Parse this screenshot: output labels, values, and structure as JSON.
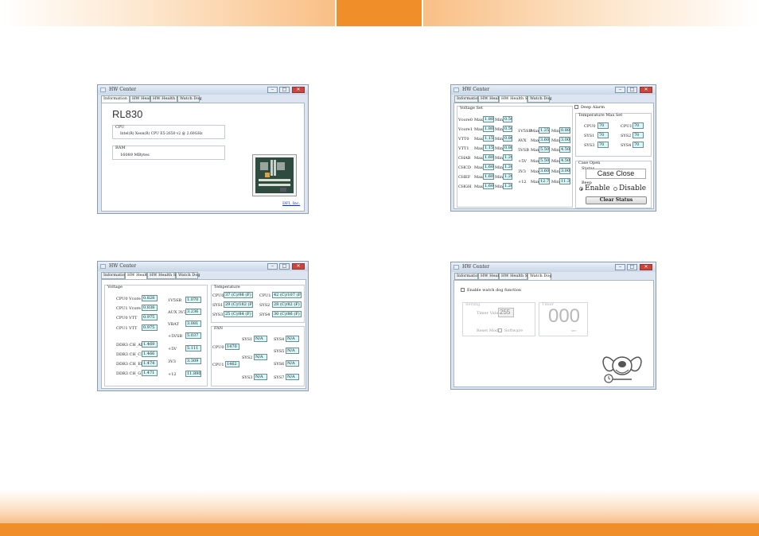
{
  "header": {
    "tab_label": ""
  },
  "colors": {
    "accent": "#f08f2a"
  },
  "window_title": "HW Center",
  "tabs": [
    "Information",
    "HW Health",
    "HW Health Set",
    "Watch Dog"
  ],
  "info": {
    "model": "RL830",
    "cpu_label": "CPU",
    "cpu_value": "Intel(R) Xeon(R) CPU E5-2650 v2 @ 2.60GHz",
    "ram_label": "RAM",
    "ram_value": "16089 MBytes",
    "link": "DFI, Inc."
  },
  "health_set": {
    "voltage_title": "Voltage Set",
    "left": [
      {
        "label": "Vcore0",
        "max": "1.80",
        "min": "0.50"
      },
      {
        "label": "Vcore1",
        "max": "1.80",
        "min": "0.50"
      },
      {
        "label": "VTT0",
        "max": "1.15",
        "min": "0.80"
      },
      {
        "label": "VTT1",
        "max": "1.15",
        "min": "0.80"
      },
      {
        "label": "CHAB",
        "max": "1.60",
        "min": "1.20"
      },
      {
        "label": "CHCD",
        "max": "1.60",
        "min": "1.20"
      },
      {
        "label": "CHEF",
        "max": "1.60",
        "min": "1.20"
      },
      {
        "label": "CHGH",
        "max": "1.60",
        "min": "1.20"
      }
    ],
    "right": [
      {
        "label": "1V5SB",
        "max": "1.25",
        "min": "0.80"
      },
      {
        "label": "AVX",
        "max": "3.60",
        "min": "3.00"
      },
      {
        "label": "5VSB",
        "max": "5.50",
        "min": "4.50"
      },
      {
        "label": "+5V",
        "max": "5.50",
        "min": "4.50"
      },
      {
        "label": "3V3",
        "max": "3.60",
        "min": "3.00"
      },
      {
        "label": "+12",
        "max": "12.75",
        "min": "11.30"
      }
    ],
    "max_label": "Max",
    "min_label": "Min",
    "deep_alarm": "Deep Alarm",
    "temp_title": "Temperature Max Set",
    "temps": [
      {
        "label": "CPU0",
        "value": "70"
      },
      {
        "label": "CPU1",
        "value": "70"
      },
      {
        "label": "SYS1",
        "value": "70"
      },
      {
        "label": "SYS2",
        "value": "70"
      },
      {
        "label": "SYS3",
        "value": "70"
      },
      {
        "label": "SYS4",
        "value": "70"
      }
    ],
    "case_open": "Case Open",
    "status_label": "Status",
    "case_status": "Case Close",
    "beep_label": "Beep",
    "enable": "Enable",
    "disable": "Disable",
    "clear_status": "Clear Status"
  },
  "health": {
    "voltage_title": "Voltage",
    "volts_left": [
      {
        "label": "CPU0 Vcore",
        "value": "0.828"
      },
      {
        "label": "CPU1 Vcore",
        "value": "0.838"
      },
      {
        "label": "CPU0 VTT",
        "value": "0.975"
      },
      {
        "label": "CPU1 VTT",
        "value": "0.975"
      },
      {
        "label": "DDR3 CH_AB",
        "value": "1.469"
      },
      {
        "label": "DDR3 CH_CD",
        "value": "1.466"
      },
      {
        "label": "DDR3 CH_EF",
        "value": "1.474"
      },
      {
        "label": "DDR3 CH_GH",
        "value": "1.471"
      }
    ],
    "volts_right": [
      {
        "label": "1V5SB",
        "value": "1.070"
      },
      {
        "label": "AUX 3V3",
        "value": "3.236"
      },
      {
        "label": "VBAT",
        "value": "3.081"
      },
      {
        "label": "+5VSB",
        "value": "5.037"
      },
      {
        "label": "+5V",
        "value": "5.111"
      },
      {
        "label": "3V3",
        "value": "3.309"
      },
      {
        "label": "+12",
        "value": "11.890"
      }
    ],
    "temp_title": "Temperature",
    "temps": [
      {
        "label": "CPU0",
        "value": "37 (C)/98 (F)"
      },
      {
        "label": "CPU1",
        "value": "42 (C)/107 (F)"
      },
      {
        "label": "SYS1",
        "value": "29 (C)/182 (F)"
      },
      {
        "label": "SYS2",
        "value": "28 (C)/82 (F)"
      },
      {
        "label": "SYS3",
        "value": "25 (C)/84 (F)"
      },
      {
        "label": "SYS4",
        "value": "30 (C)/86 (F)"
      }
    ],
    "fan_title": "FAN",
    "fans_cpu": [
      {
        "label": "CPU0",
        "value": "1470"
      },
      {
        "label": "CPU1",
        "value": "1462"
      }
    ],
    "fans_sys": [
      {
        "label": "SYS1",
        "value": "N/A"
      },
      {
        "label": "SYS4",
        "value": "N/A"
      },
      {
        "label": "SYS2",
        "value": "N/A"
      },
      {
        "label": "SYS5",
        "value": "N/A"
      },
      {
        "label": "SYS6",
        "value": "N/A"
      },
      {
        "label": "SYS3",
        "value": "N/A"
      },
      {
        "label": "SYS7",
        "value": "N/A"
      }
    ]
  },
  "watchdog": {
    "enable_label": "Enable watch dog function",
    "setting_title": "Setting",
    "timer_value_label": "Timer Value",
    "timer_value": "255",
    "reset_mode_label": "Reset Mode",
    "software_label": "Software",
    "timer_title": "Timer",
    "timer_display": "000",
    "sec_label": "sec"
  }
}
